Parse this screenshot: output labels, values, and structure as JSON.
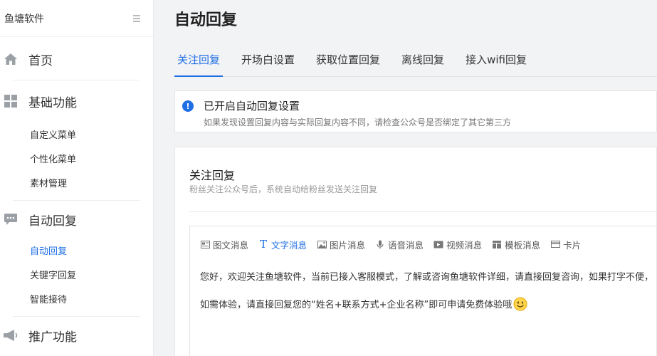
{
  "brand": {
    "name": "鱼塘软件"
  },
  "sidebar": {
    "sections": [
      {
        "label": "首页",
        "icon": "home-icon",
        "items": []
      },
      {
        "label": "基础功能",
        "icon": "grid-icon",
        "items": [
          "自定义菜单",
          "个性化菜单",
          "素材管理"
        ]
      },
      {
        "label": "自动回复",
        "icon": "chat-icon",
        "items": [
          "自动回复",
          "关键字回复",
          "智能接待"
        ]
      },
      {
        "label": "推广功能",
        "icon": "megaphone-icon",
        "items": []
      }
    ],
    "active_item": "自动回复"
  },
  "page": {
    "title": "自动回复"
  },
  "tabs": [
    "关注回复",
    "开场白设置",
    "获取位置回复",
    "离线回复",
    "接入wifi回复"
  ],
  "notice": {
    "title": "已开启自动回复设置",
    "desc": "如果发现设置回复内容与实际回复内容不同，请检查公众号是否绑定了其它第三方"
  },
  "card": {
    "title": "关注回复",
    "desc": "粉丝关注公众号后，系统自动给粉丝发送关注回复"
  },
  "toolbar": [
    "图文消息",
    "文字消息",
    "图片消息",
    "语音消息",
    "视频消息",
    "模板消息",
    "卡片"
  ],
  "message": {
    "line1": "您好，欢迎关注鱼塘软件，当前已接入客服模式，了解或咨询鱼塘软件详细，请直接回复咨询，如果打字不便，",
    "line2": "如需体验，请直接回复您的“姓名+联系方式+企业名称”即可申请免费体验哦"
  },
  "colors": {
    "accent": "#1f6fe5"
  }
}
